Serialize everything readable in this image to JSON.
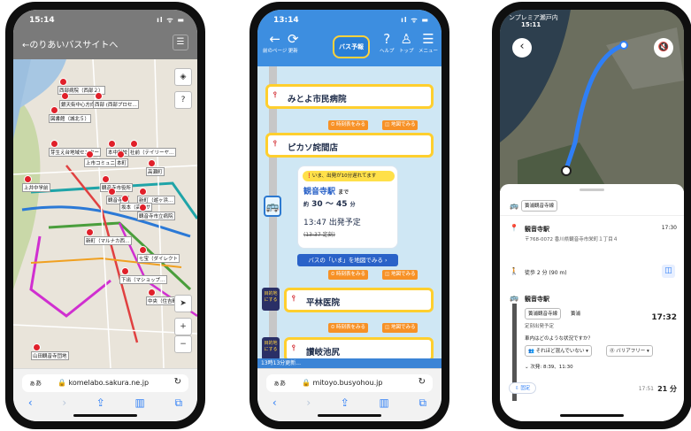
{
  "phone1": {
    "status_time": "15:14",
    "status_icons": "ıl ᯤ ▬",
    "header_title": "←のりあいバスサイトへ",
    "menu_icon": "☰",
    "map_controls": {
      "layers": "◈",
      "help": "?",
      "locate": "➤",
      "zoom_in": "+",
      "zoom_out": "−"
    },
    "map_labels": [
      "西部病院（西部２）",
      "銀天街中心方向",
      "西部 (西部プロセ…",
      "図書館（城北５）",
      "芽生え台地域センター",
      "上市コミュニティ",
      "本中学校",
      "社前（テイリーヤ…",
      "高瀬町",
      "本町",
      "上井中学前",
      "観音寺市役所",
      "観音寺駅",
      "新町（遊ヶ浜…",
      "坂本（高松サ",
      "観音寺市立病院",
      "新町（マルナカ西…",
      "七宝（ダイレクト",
      "下出（マショップ…",
      "中央（住吉町…",
      "山田観音寺団地"
    ],
    "url": "komelabo.sakura.ne.jp"
  },
  "phone2": {
    "status_time": "13:14",
    "header": {
      "back": "前のページ",
      "refresh": "更新",
      "logo": "バス予報",
      "help": "ヘルプ",
      "top": "トップ",
      "menu": "メニュー"
    },
    "stops": [
      {
        "name": "みとよ市民病院"
      },
      {
        "name": "ピカソ詫間店"
      },
      {
        "name": "平林医院"
      },
      {
        "name": "讃岐池尻"
      }
    ],
    "btn_timetable": "時刻表をみる",
    "btn_map": "地図でみる",
    "alert": "いま、出発が10分遅れてます",
    "dest": "観音寺駅",
    "dest_suffix": "まで",
    "eta_prefix": "約",
    "eta_range": "30 ～ 45",
    "eta_unit": "分",
    "depart_time": "13:47 出発予定",
    "orig_time": "(13:37 定刻)",
    "map_now_btn": "バスの「いま」を地図でみる ›",
    "tag_label": "目的地にする",
    "update_text": "13時13分更新...",
    "url": "mitoyo.busyohou.jp"
  },
  "phone3": {
    "status_time": "15:11",
    "banner": "ンプレミア瀬戸内",
    "route_chip": "簀浦観音寺線",
    "stop1_name": "観音寺駅",
    "stop1_time": "17:30",
    "stop1_address": "〒768-0072 香川県観音寺市栄町１丁目４",
    "walk": "徒歩 2 分 (90 m)",
    "stop2_name": "観音寺駅",
    "chip_line": "簀浦観音寺線",
    "chip_dir": "簀浦",
    "scheduled": "定刻出発予定",
    "stop2_time": "17:32",
    "question": "車内はどのような状況ですか？",
    "crowd_btn": "それほど混んでいない ▾",
    "barrier_btn": "バリアフリー ▾",
    "next": "次発: 8:39、11:30",
    "pin_btn": "固定",
    "arrive": "17:51",
    "duration": "21 分"
  },
  "colors": {
    "pin_red": "#e0202a",
    "bus_blue": "#3d8ee0",
    "stop_yellow": "#ffcf2e",
    "orange": "#f79126",
    "route_blue": "#2f7ff6"
  }
}
